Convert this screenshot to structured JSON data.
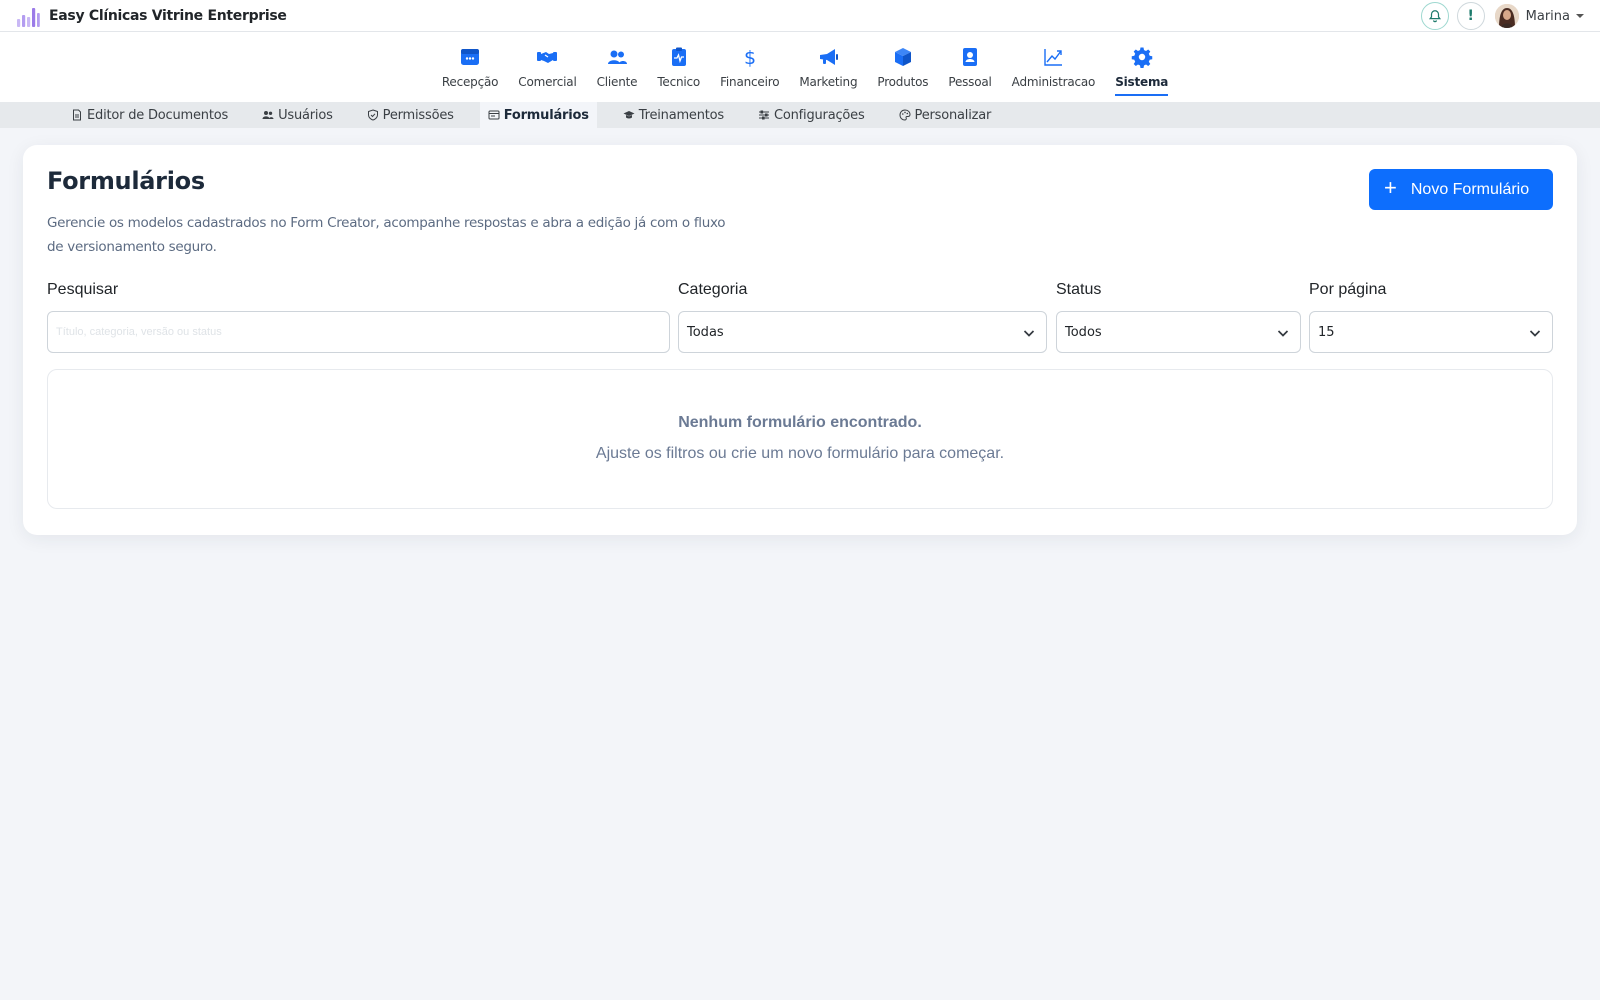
{
  "app": {
    "title": "Easy Clínicas Vitrine Enterprise"
  },
  "user": {
    "name": "Marina"
  },
  "colors": {
    "accent": "#0d6efd",
    "brand_purple": "#9b7be8",
    "teal": "#1d7a6b"
  },
  "main_nav": {
    "items": [
      {
        "label": "Recepção",
        "icon": "reception-icon"
      },
      {
        "label": "Comercial",
        "icon": "handshake-icon"
      },
      {
        "label": "Cliente",
        "icon": "users-icon"
      },
      {
        "label": "Tecnico",
        "icon": "clipboard-pulse-icon"
      },
      {
        "label": "Financeiro",
        "icon": "dollar-icon"
      },
      {
        "label": "Marketing",
        "icon": "megaphone-icon"
      },
      {
        "label": "Produtos",
        "icon": "box-icon"
      },
      {
        "label": "Pessoal",
        "icon": "id-badge-icon"
      },
      {
        "label": "Administracao",
        "icon": "chart-line-icon"
      },
      {
        "label": "Sistema",
        "icon": "gear-icon",
        "active": true
      }
    ]
  },
  "sub_nav": {
    "items": [
      {
        "label": "Editor de Documentos",
        "icon": "file-icon"
      },
      {
        "label": "Usuários",
        "icon": "users-icon"
      },
      {
        "label": "Permissões",
        "icon": "shield-icon"
      },
      {
        "label": "Formulários",
        "icon": "form-icon",
        "active": true
      },
      {
        "label": "Treinamentos",
        "icon": "graduation-cap-icon"
      },
      {
        "label": "Configurações",
        "icon": "sliders-icon"
      },
      {
        "label": "Personalizar",
        "icon": "palette-icon"
      }
    ]
  },
  "page": {
    "title": "Formulários",
    "description": "Gerencie os modelos cadastrados no Form Creator, acompanhe respostas e abra a edição já com o fluxo de versionamento seguro.",
    "new_button": "Novo Formulário"
  },
  "filters": {
    "search": {
      "label": "Pesquisar",
      "placeholder": "Título, categoria, versão ou status",
      "value": ""
    },
    "category": {
      "label": "Categoria",
      "value": "Todas"
    },
    "status": {
      "label": "Status",
      "value": "Todos"
    },
    "per_page": {
      "label": "Por página",
      "value": "15"
    }
  },
  "empty_state": {
    "title": "Nenhum formulário encontrado.",
    "subtitle": "Ajuste os filtros ou crie um novo formulário para começar."
  }
}
